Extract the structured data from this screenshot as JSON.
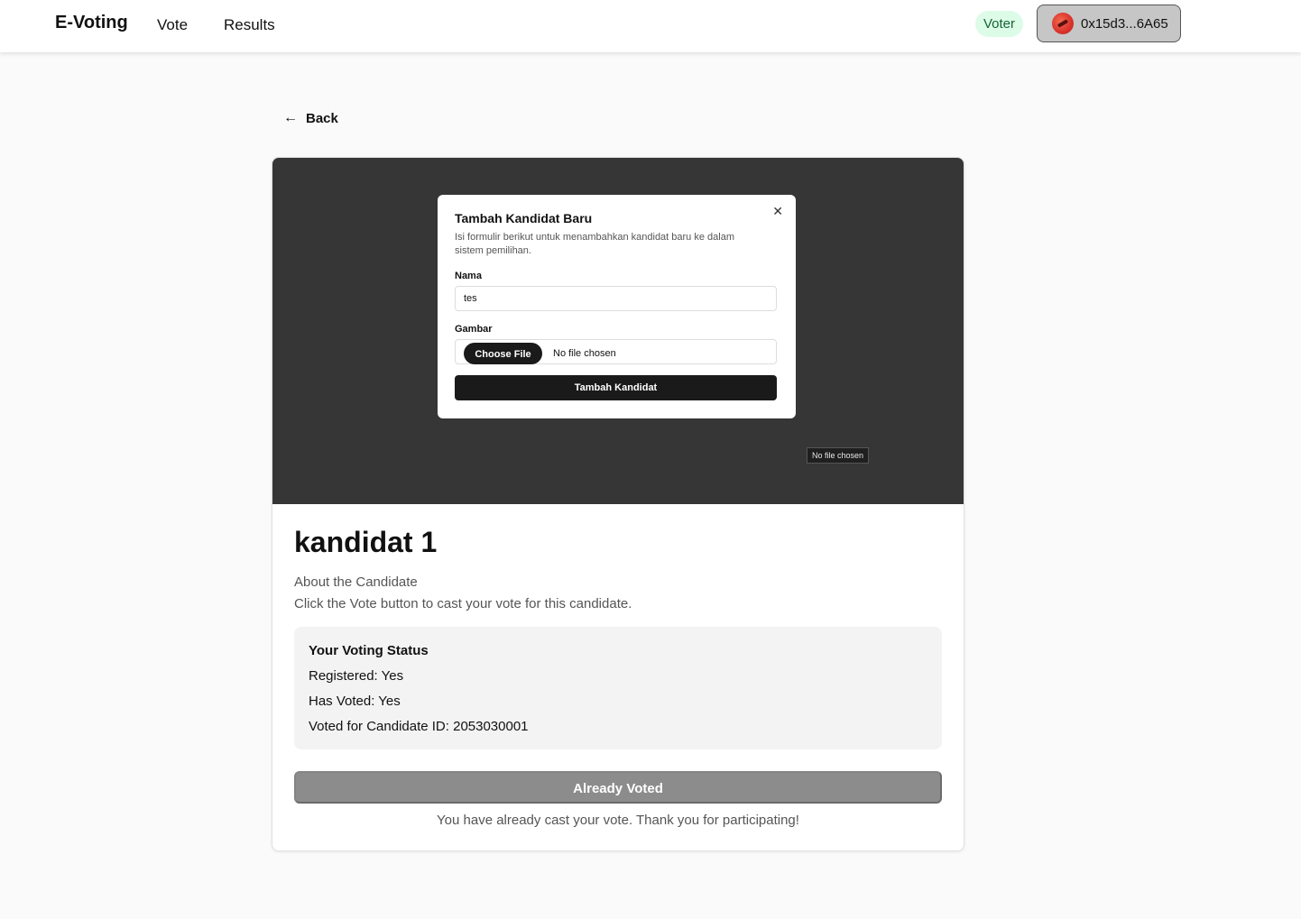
{
  "nav": {
    "brand": "E-Voting",
    "links": [
      "Vote",
      "Results"
    ],
    "role_badge": "Voter",
    "wallet_address": "0x15d3...6A65"
  },
  "back": {
    "label": "Back"
  },
  "image_dialog": {
    "title": "Tambah Kandidat Baru",
    "description": "Isi formulir berikut untuk menambahkan kandidat baru ke dalam sistem pemilihan.",
    "name_label": "Nama",
    "name_value": "tes",
    "image_label": "Gambar",
    "choose_file_label": "Choose File",
    "file_status": "No file chosen",
    "submit_label": "Tambah Kandidat",
    "close_icon": "close-icon"
  },
  "image_tooltip": "No file chosen",
  "candidate": {
    "name": "kandidat 1",
    "about_heading": "About the Candidate",
    "about_text": "Click the Vote button to cast your vote for this candidate."
  },
  "voting_status": {
    "title": "Your Voting Status",
    "registered": "Registered: Yes",
    "has_voted": "Has Voted: Yes",
    "voted_for": "Voted for Candidate ID: 2053030001"
  },
  "vote_button": {
    "label": "Already Voted"
  },
  "vote_note": "You have already cast your vote. Thank you for participating!",
  "colors": {
    "badge_bg": "#dcfce7",
    "badge_text": "#166534",
    "disabled_button": "#8c8c8c",
    "image_bg": "#363636"
  }
}
